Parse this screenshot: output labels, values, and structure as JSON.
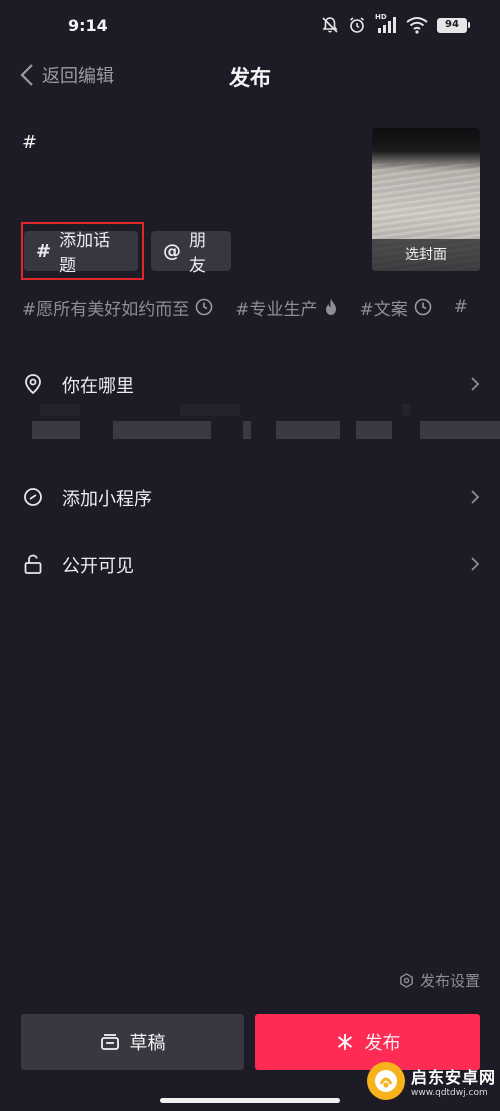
{
  "status_bar": {
    "time": "9:14",
    "network_label": "HD",
    "battery": "94",
    "icons": [
      "mute-icon",
      "alarm-icon",
      "signal-icon",
      "wifi-icon",
      "battery-icon"
    ]
  },
  "nav": {
    "back_label": "返回编辑",
    "title": "发布"
  },
  "editor": {
    "caption": "#"
  },
  "cover": {
    "label": "选封面"
  },
  "chips": {
    "topic_symbol": "#",
    "topic_label": "添加话题",
    "friend_symbol": "@",
    "friend_label": "朋友"
  },
  "suggested_topics": [
    {
      "text": "#愿所有美好如约而至",
      "icon": "clock-icon"
    },
    {
      "text": "#专业生产",
      "icon": "fire-icon"
    },
    {
      "text": "#文案",
      "icon": "clock-icon"
    },
    {
      "text": "#",
      "icon": ""
    }
  ],
  "menu": {
    "location": "你在哪里",
    "mini_program": "添加小程序",
    "visibility": "公开可见"
  },
  "footer": {
    "publish_settings": "发布设置",
    "draft_label": "草稿",
    "publish_label": "发布"
  },
  "watermark": {
    "name": "启东安卓网",
    "url": "www.qdtdwj.com"
  },
  "colors": {
    "background": "#1c1b26",
    "chip": "#373641",
    "draft_button": "#383742",
    "publish_button": "#fe2c55",
    "highlight": "#e0262c"
  }
}
